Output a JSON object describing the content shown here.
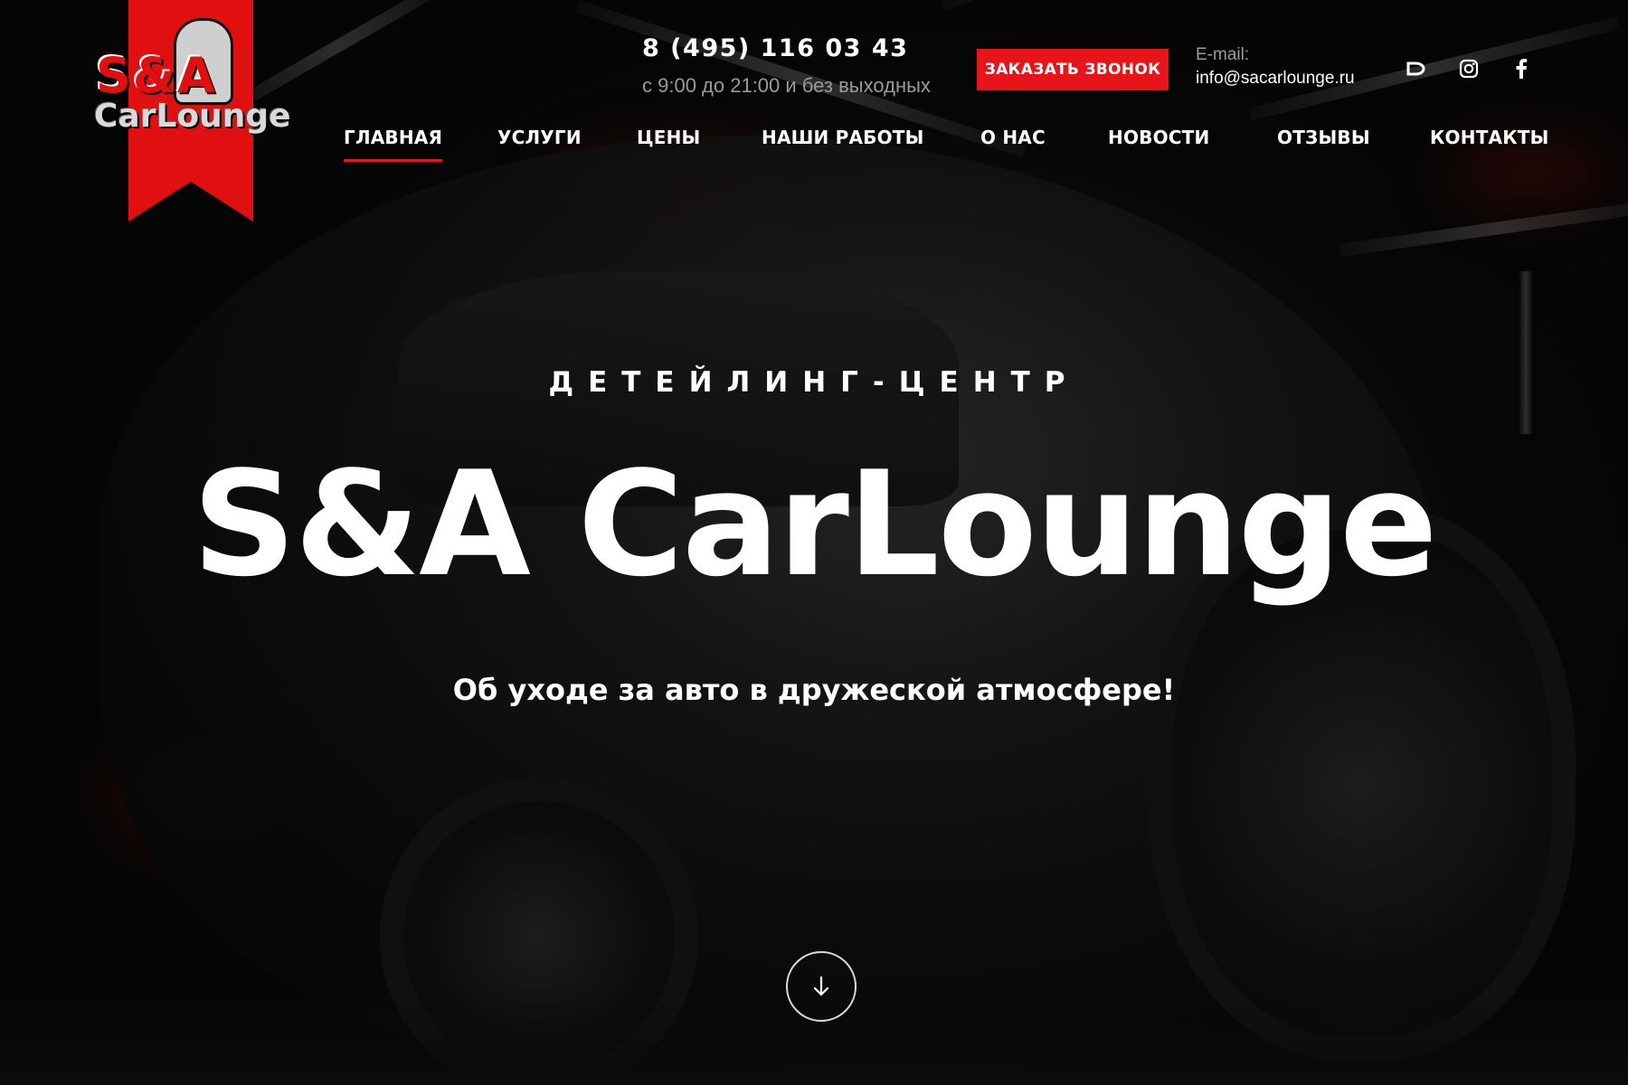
{
  "logo": {
    "text_top": "S&A",
    "text_bottom": "CarLounge"
  },
  "header": {
    "phone": "8 (495) 116 03 43",
    "hours": "с 9:00 до 21:00 и без выходных",
    "callback_label": "ЗАКАЗАТЬ ЗВОНОК",
    "email_label": "E-mail:",
    "email": "info@sacarlounge.ru",
    "social_icons": [
      "d-icon",
      "instagram-icon",
      "facebook-icon"
    ]
  },
  "nav": {
    "items": [
      {
        "label": "ГЛАВНАЯ",
        "active": true
      },
      {
        "label": "УСЛУГИ"
      },
      {
        "label": "ЦЕНЫ"
      },
      {
        "label": "НАШИ РАБОТЫ"
      },
      {
        "label": "О НАС"
      },
      {
        "label": "НОВОСТИ"
      },
      {
        "label": "ОТЗЫВЫ"
      },
      {
        "label": "КОНТАКТЫ"
      }
    ]
  },
  "hero": {
    "eyebrow": "ДЕТЕЙЛИНГ-ЦЕНТР",
    "title": "S&A CarLounge",
    "tagline": "Об уходе за авто в дружеской атмосфере!"
  },
  "colors": {
    "accent": "#e8141a",
    "text": "#ffffff",
    "muted": "#9a9a9a",
    "background": "#0a0a0a"
  }
}
